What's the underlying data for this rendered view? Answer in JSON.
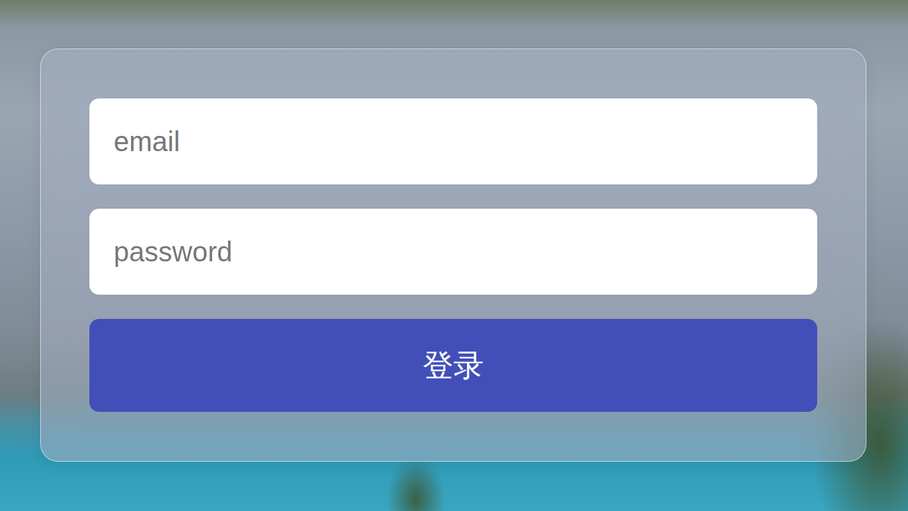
{
  "form": {
    "fields": [
      {
        "placeholder": "email",
        "kind": "email"
      },
      {
        "placeholder": "password",
        "kind": "password"
      }
    ],
    "button": "登录"
  }
}
